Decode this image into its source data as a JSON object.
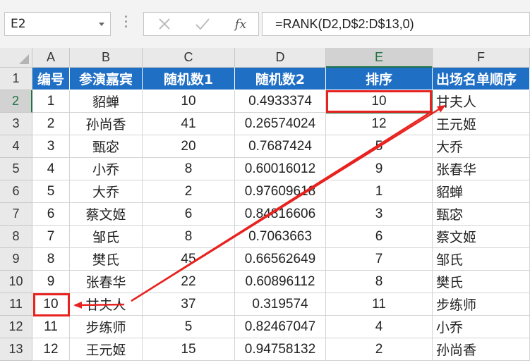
{
  "formula_bar": {
    "name_box": "E2",
    "cancel_icon": "x-icon",
    "enter_icon": "check-icon",
    "fx_label": "fx",
    "formula": "=RANK(D2,D$2:D$13,0)"
  },
  "columns": [
    "A",
    "B",
    "C",
    "D",
    "E",
    "F"
  ],
  "header_row": [
    "编号",
    "参演嘉宾",
    "随机数1",
    "随机数2",
    "排序",
    "出场名单顺序"
  ],
  "rows": [
    {
      "num": "2",
      "cells": [
        "1",
        "貂蝉",
        "10",
        "0.4933374",
        "10",
        "甘夫人"
      ]
    },
    {
      "num": "3",
      "cells": [
        "2",
        "孙尚香",
        "41",
        "0.26574024",
        "12",
        "王元姬"
      ]
    },
    {
      "num": "4",
      "cells": [
        "3",
        "甄宓",
        "20",
        "0.7687424",
        "5",
        "大乔"
      ]
    },
    {
      "num": "5",
      "cells": [
        "4",
        "小乔",
        "8",
        "0.60016012",
        "9",
        "张春华"
      ]
    },
    {
      "num": "6",
      "cells": [
        "5",
        "大乔",
        "2",
        "0.97609618",
        "1",
        "貂蝉"
      ]
    },
    {
      "num": "7",
      "cells": [
        "6",
        "蔡文姬",
        "6",
        "0.84816606",
        "3",
        "甄宓"
      ]
    },
    {
      "num": "8",
      "cells": [
        "7",
        "邹氏",
        "8",
        "0.7063663",
        "6",
        "蔡文姬"
      ]
    },
    {
      "num": "9",
      "cells": [
        "8",
        "樊氏",
        "45",
        "0.66562649",
        "7",
        "邹氏"
      ]
    },
    {
      "num": "10",
      "cells": [
        "9",
        "张春华",
        "22",
        "0.60896112",
        "8",
        "樊氏"
      ]
    },
    {
      "num": "11",
      "cells": [
        "10",
        "甘夫人",
        "37",
        "0.319574",
        "11",
        "步练师"
      ]
    },
    {
      "num": "12",
      "cells": [
        "11",
        "步练师",
        "5",
        "0.82467047",
        "4",
        "小乔"
      ]
    },
    {
      "num": "13",
      "cells": [
        "12",
        "王元姬",
        "15",
        "0.94758132",
        "2",
        "孙尚香"
      ]
    }
  ],
  "header_row_num": "1",
  "selected_cell": "E2",
  "colors": {
    "header_fill": "#1f6fc5",
    "annotation_red": "#e8221f",
    "selection_green": "#217346"
  }
}
